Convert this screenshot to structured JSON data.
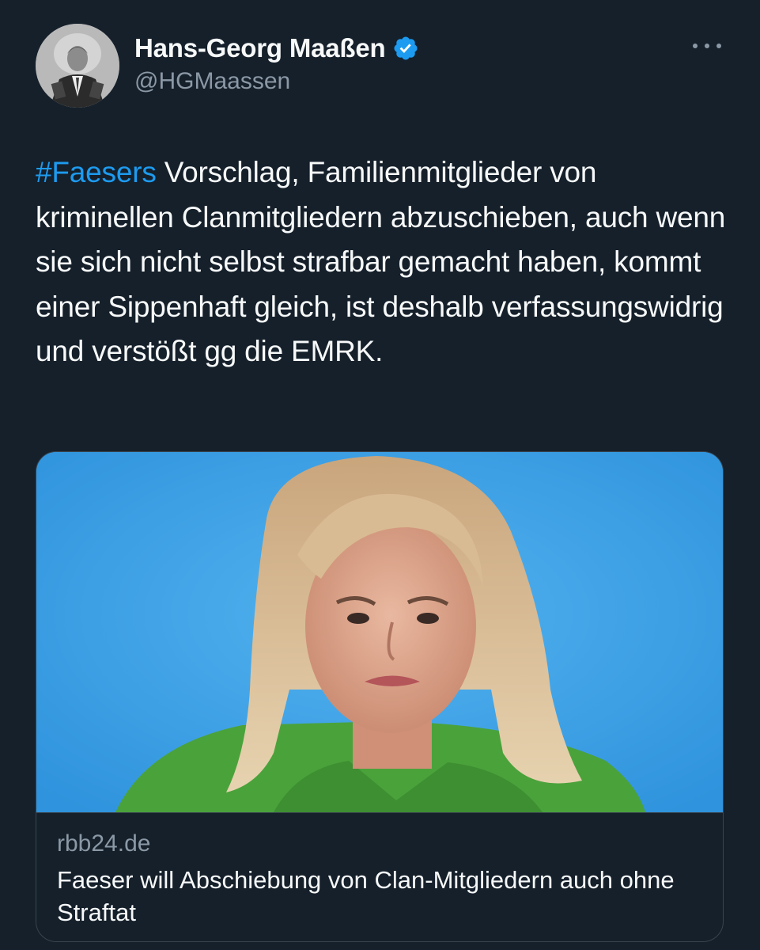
{
  "author": {
    "name": "Hans-Georg Maaßen",
    "handle": "@HGMaassen",
    "verified": true,
    "avatar_icon": "profile-photo"
  },
  "tweet": {
    "hashtag": "#Faesers",
    "text": " Vorschlag, Familienmitglieder von kriminellen Clanmitgliedern abzuschieben, auch wenn sie sich nicht selbst strafbar gemacht haben, kommt einer Sippenhaft gleich, ist deshalb verfassungswidrig und verstößt gg die EMRK."
  },
  "link_card": {
    "domain": "rbb24.de",
    "title": "Faeser will Abschiebung von Clan-Mitgliedern auch ohne Straftat",
    "image_icon": "article-photo"
  },
  "colors": {
    "background": "#15202b",
    "text": "#f7f9f9",
    "secondary_text": "#8b98a5",
    "accent": "#1d9bf0",
    "border": "#38444d"
  }
}
